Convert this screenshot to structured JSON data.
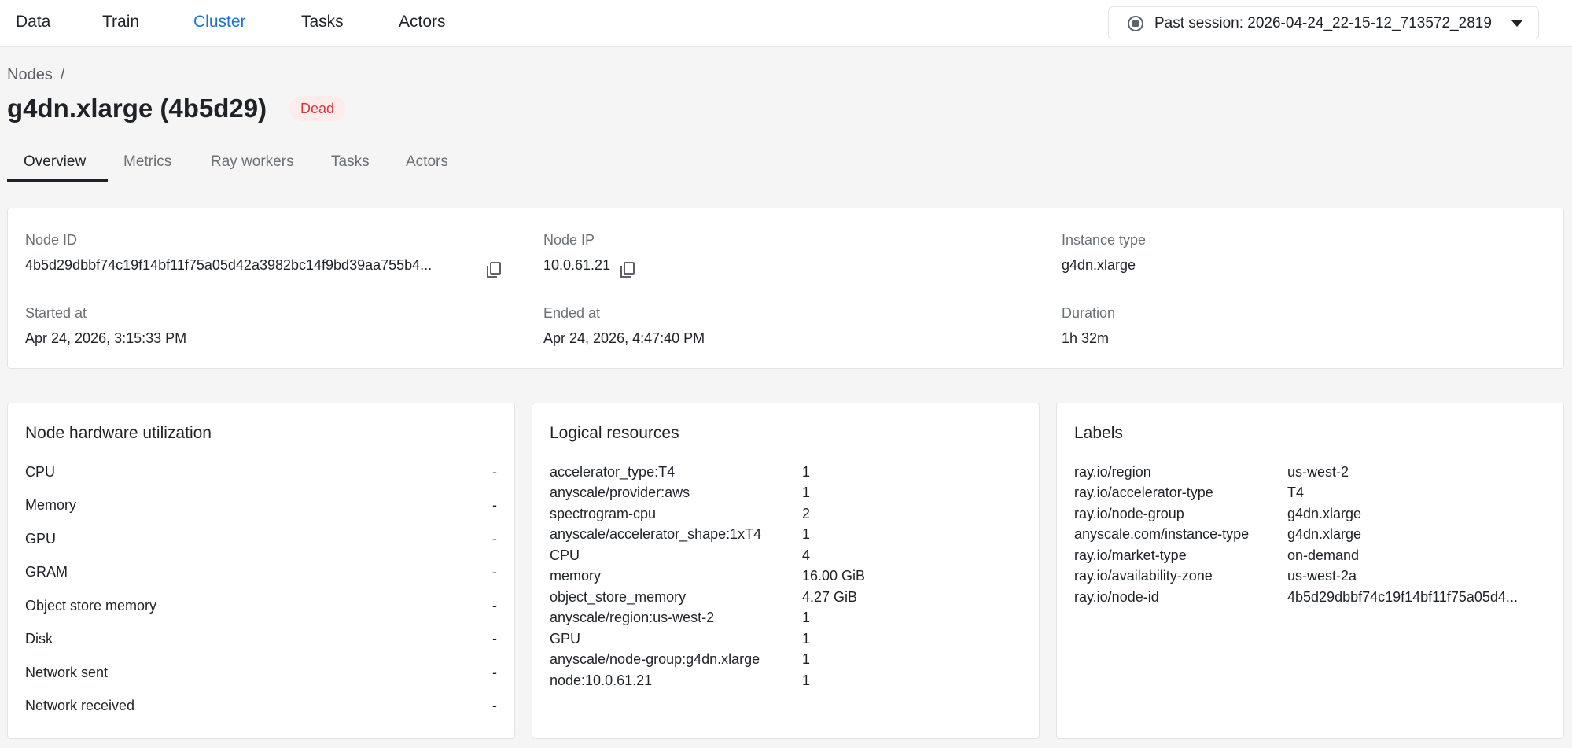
{
  "nav": {
    "items": [
      "Data",
      "Train",
      "Cluster",
      "Tasks",
      "Actors"
    ],
    "active": "Cluster",
    "session_label": "Past session: 2026-04-24_22-15-12_713572_2819"
  },
  "header": {
    "breadcrumb": "Nodes",
    "breadcrumb_sep": "/",
    "title": "g4dn.xlarge (4b5d29)",
    "status": "Dead"
  },
  "tabs": [
    "Overview",
    "Metrics",
    "Ray workers",
    "Tasks",
    "Actors"
  ],
  "overview": {
    "node_id_label": "Node ID",
    "node_id": "4b5d29dbbf74c19f14bf11f75a05d42a3982bc14f9bd39aa755b4...",
    "node_ip_label": "Node IP",
    "node_ip": "10.0.61.21",
    "instance_type_label": "Instance type",
    "instance_type": "g4dn.xlarge",
    "started_label": "Started at",
    "started": "Apr 24, 2026, 3:15:33 PM",
    "ended_label": "Ended at",
    "ended": "Apr 24, 2026, 4:47:40 PM",
    "duration_label": "Duration",
    "duration": "1h 32m"
  },
  "hardware": {
    "title": "Node hardware utilization",
    "rows": [
      {
        "name": "CPU",
        "value": "-"
      },
      {
        "name": "Memory",
        "value": "-"
      },
      {
        "name": "GPU",
        "value": "-"
      },
      {
        "name": "GRAM",
        "value": "-"
      },
      {
        "name": "Object store memory",
        "value": "-"
      },
      {
        "name": "Disk",
        "value": "-"
      },
      {
        "name": "Network sent",
        "value": "-"
      },
      {
        "name": "Network received",
        "value": "-"
      }
    ]
  },
  "logical": {
    "title": "Logical resources",
    "rows": [
      {
        "key": "accelerator_type:T4",
        "value": "1"
      },
      {
        "key": "anyscale/provider:aws",
        "value": "1"
      },
      {
        "key": "spectrogram-cpu",
        "value": "2"
      },
      {
        "key": "anyscale/accelerator_shape:1xT4",
        "value": "1"
      },
      {
        "key": "CPU",
        "value": "4"
      },
      {
        "key": "memory",
        "value": "16.00 GiB"
      },
      {
        "key": "object_store_memory",
        "value": "4.27 GiB"
      },
      {
        "key": "anyscale/region:us-west-2",
        "value": "1"
      },
      {
        "key": "GPU",
        "value": "1"
      },
      {
        "key": "anyscale/node-group:g4dn.xlarge",
        "value": "1"
      },
      {
        "key": "node:10.0.61.21",
        "value": "1"
      }
    ]
  },
  "labels": {
    "title": "Labels",
    "rows": [
      {
        "key": "ray.io/region",
        "value": "us-west-2"
      },
      {
        "key": "ray.io/accelerator-type",
        "value": "T4"
      },
      {
        "key": "ray.io/node-group",
        "value": "g4dn.xlarge"
      },
      {
        "key": "anyscale.com/instance-type",
        "value": "g4dn.xlarge"
      },
      {
        "key": "ray.io/market-type",
        "value": "on-demand"
      },
      {
        "key": "ray.io/availability-zone",
        "value": "us-west-2a"
      },
      {
        "key": "ray.io/node-id",
        "value": "4b5d29dbbf74c19f14bf11f75a05d4..."
      }
    ]
  },
  "colors": {
    "accent": "#1a73d9",
    "dead_badge_bg": "#fdecec",
    "dead_badge_text": "#d93636"
  }
}
